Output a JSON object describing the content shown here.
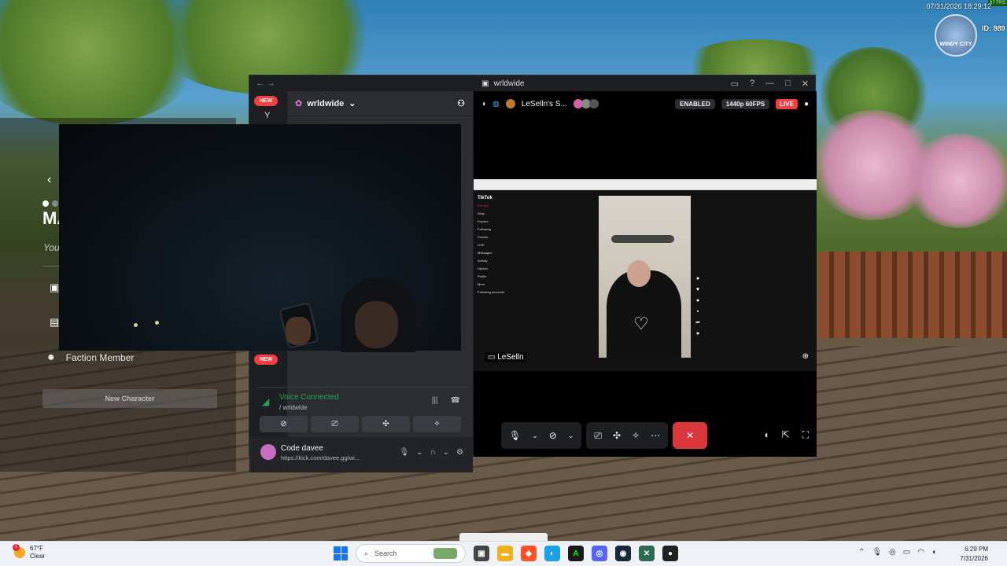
{
  "hud": {
    "timestamp": "07/31/2026 18:29:12",
    "fps": "97 FPS",
    "logo_text": "WINDY CITY",
    "id_label": "ID: 889"
  },
  "char_menu": {
    "title_partial": "MA",
    "subtitle_partial": "Youi",
    "faction_label": "Faction Member",
    "new_character_label": "New Character"
  },
  "discord": {
    "window_title": "wrldwide",
    "server_name": "wrldwide",
    "new_badge": "NEW",
    "rail_letter": "Y",
    "voice": {
      "status": "Voice Connected",
      "channel": "/ wrldwide"
    },
    "user": {
      "name": "Code davee",
      "status": "https://kick.com/davee.gg/wi..."
    },
    "stream": {
      "streamer_short": "LeSelln's S...",
      "enabled_label": "ENABLED",
      "quality_label": "1440p 60FPS",
      "live_label": "LIVE",
      "name_tag": "LeSelln",
      "tiktok_logo": "TikTok",
      "tiktok_menu": [
        "For You",
        "Shop",
        "Explore",
        "Following",
        "Friends",
        "LIVE",
        "Messages",
        "Activity",
        "Upload",
        "Profile",
        "More"
      ],
      "tiktok_following_header": "Following accounts"
    }
  },
  "taskbar": {
    "weather_temp": "67°F",
    "weather_desc": "Clear",
    "weather_alert": "1",
    "search_placeholder": "Search",
    "time": "6:29 PM",
    "date": "7/31/2026"
  },
  "colors": {
    "discord_green": "#23a55a",
    "discord_red": "#f23f43",
    "end_call": "#da373c"
  }
}
